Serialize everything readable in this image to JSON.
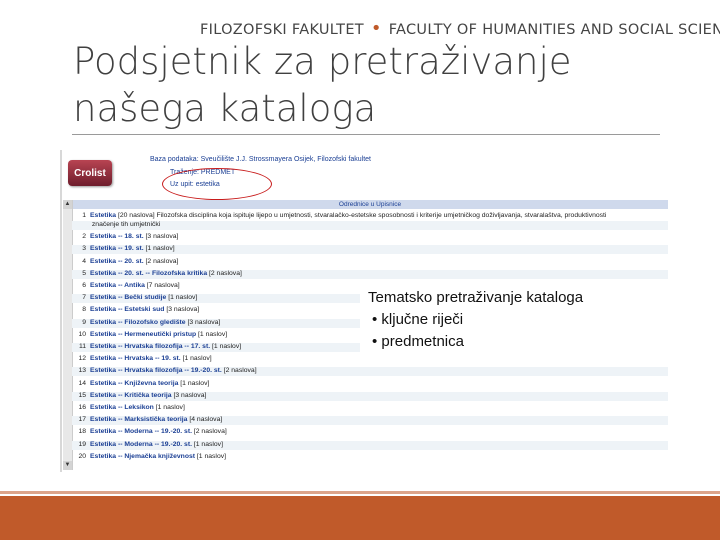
{
  "header": {
    "brand_left": "FILOZOFSKI FAKULTET",
    "brand_sep": "•",
    "brand_right": "FACULTY OF HUMANITIES AND SOCIAL SCIENCES"
  },
  "title": {
    "line1": "Podsjetnik za pretraživanje",
    "line2": "našega kataloga"
  },
  "catalog": {
    "logo": "Crolist",
    "baza_label": "Baza podataka:",
    "baza_value": "Sveučilište J.J. Strossmayera Osijek, Filozofski fakultet",
    "trazenje_label": "Traženje:",
    "trazenje_value": "PREDMET",
    "upit_label": "Uz upit:",
    "upit_value": "estetika",
    "results_header": "Odrednice u Upisnice",
    "rows": [
      {
        "n": "1",
        "term": "Estetika",
        "rest": "[20 naslova] Filozofska disciplina koja ispituje lijepo u umjetnosti, stvaralačko-estetske sposobnosti i kriterije umjetničkog doživljavanja, stvaralaštva, produktivnosti"
      },
      {
        "n": "",
        "term": "",
        "rest": "značenje tih umjetnički"
      },
      {
        "n": "2",
        "term": "Estetika -- 18. st.",
        "rest": "[3 naslova]"
      },
      {
        "n": "3",
        "term": "Estetika -- 19. st.",
        "rest": "[1 naslov]"
      },
      {
        "n": "4",
        "term": "Estetika -- 20. st.",
        "rest": "[2 naslova]"
      },
      {
        "n": "5",
        "term": "Estetika -- 20. st. -- Filozofska kritika",
        "rest": "[2 naslova]"
      },
      {
        "n": "6",
        "term": "Estetika -- Antika",
        "rest": "[7 naslova]"
      },
      {
        "n": "7",
        "term": "Estetika -- Bečki studije",
        "rest": "[1 naslov]"
      },
      {
        "n": "8",
        "term": "Estetika -- Estetski sud",
        "rest": "[3 naslova]"
      },
      {
        "n": "9",
        "term": "Estetika -- Filozofsko gledište",
        "rest": "[3 naslova]"
      },
      {
        "n": "10",
        "term": "Estetika -- Hermeneutički pristup",
        "rest": "[1 naslov]"
      },
      {
        "n": "11",
        "term": "Estetika -- Hrvatska filozofija -- 17. st.",
        "rest": "[1 naslov]"
      },
      {
        "n": "12",
        "term": "Estetika -- Hrvatska -- 19. st.",
        "rest": "[1 naslov]"
      },
      {
        "n": "13",
        "term": "Estetika -- Hrvatska filozofija -- 19.-20. st.",
        "rest": "[2 naslova]"
      },
      {
        "n": "14",
        "term": "Estetika -- Književna teorija",
        "rest": "[1 naslov]"
      },
      {
        "n": "15",
        "term": "Estetika -- Kritička teorija",
        "rest": "[3 naslova]"
      },
      {
        "n": "16",
        "term": "Estetika -- Leksikon",
        "rest": "[1 naslov]"
      },
      {
        "n": "17",
        "term": "Estetika -- Marksistička teorija",
        "rest": "[4 naslova]"
      },
      {
        "n": "18",
        "term": "Estetika -- Moderna -- 19.-20. st.",
        "rest": "[2 naslova]"
      },
      {
        "n": "19",
        "term": "Estetika -- Moderna -- 19.-20. st.",
        "rest": "[1 naslov]"
      },
      {
        "n": "20",
        "term": "Estetika -- Njemačka književnost",
        "rest": "[1 naslov]"
      }
    ]
  },
  "overlay": {
    "heading": "Tematsko pretraživanje kataloga",
    "bullets": [
      "•  ključne riječi",
      "•  predmetnica"
    ]
  },
  "colors": {
    "accent": "#c05a2a",
    "link": "#1b3f94",
    "highlight_circle": "#c81c1c"
  }
}
